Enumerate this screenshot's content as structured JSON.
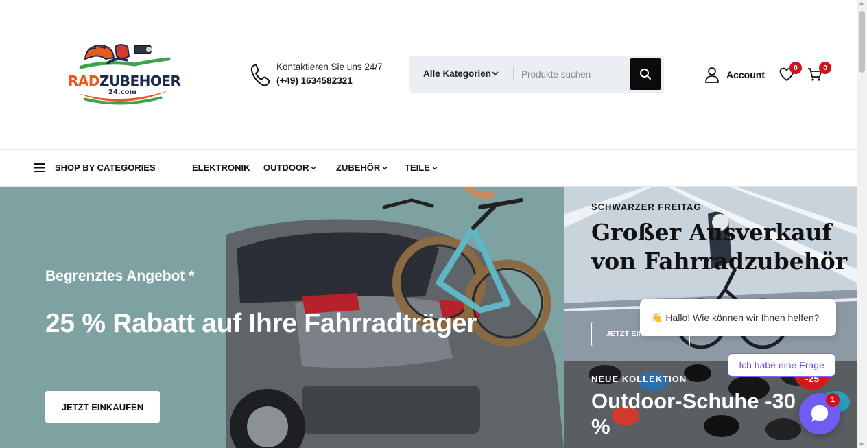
{
  "header": {
    "logo": {
      "brand_part1": "RAD",
      "brand_part2": "ZUBEHOER",
      "domain": "24.com"
    },
    "contact": {
      "label": "Kontaktieren Sie uns 24/7",
      "phone": "(+49) 1634582321"
    },
    "search": {
      "category_label": "Alle Kategorien",
      "placeholder": "Produkte suchen",
      "value": ""
    },
    "account_label": "Account",
    "wishlist_count": "0",
    "cart_count": "0"
  },
  "nav": {
    "shop_by_categories": "SHOP BY CATEGORIES",
    "items": [
      "ELEKTRONIK",
      "OUTDOOR",
      "ZUBEHÖR",
      "TEILE"
    ]
  },
  "hero": {
    "kicker": "Begrenztes Angebot *",
    "title": "25 % Rabatt auf Ihre Fahrradträger",
    "button": "JETZT EINKAUFEN"
  },
  "promo1": {
    "kicker": "SCHWARZER FREITAG",
    "title": "Großer Ausverkauf von Fahrradzubehör",
    "button": "JETZT EINKAUFEN"
  },
  "promo2": {
    "kicker": "NEUE KOLLEKTION",
    "title": "Outdoor-Schuhe -30 %"
  },
  "chat": {
    "greeting": "👋 Hallo! Wie können wir Ihnen helfen?",
    "quick_reply": "Ich habe eine Frage",
    "unread_count": "1",
    "sale_sticker": "-25"
  },
  "colors": {
    "hero_bg": "#7ea2a2",
    "badge": "#d0121b",
    "chat_accent": "#6f5cf1",
    "search_bg": "#ebeef2",
    "logo_orange": "#e8591c",
    "logo_navy": "#1d2a4d"
  }
}
